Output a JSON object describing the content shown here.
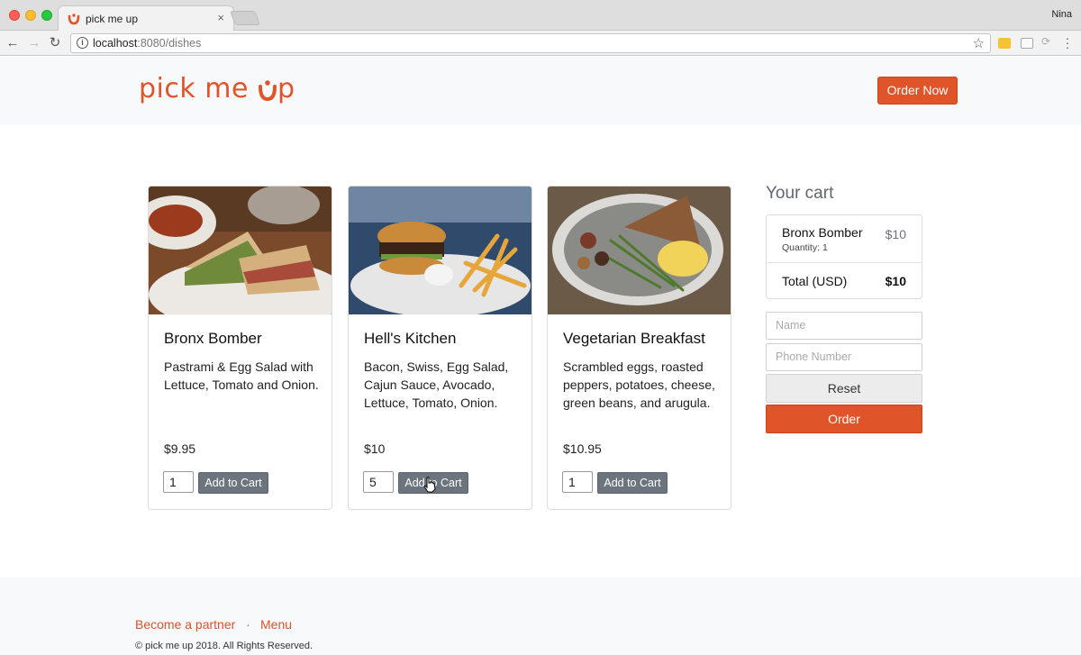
{
  "browser": {
    "tab_title": "pick me up",
    "tab_close": "×",
    "profile_name": "Nina",
    "url_host": "localhost",
    "url_path": ":8080/dishes",
    "brand_color": "#e0542a"
  },
  "header": {
    "logo_part1": "pick me ",
    "logo_part2": "p",
    "order_now_label": "Order Now"
  },
  "dishes": [
    {
      "title": "Bronx Bomber",
      "description": "Pastrami & Egg Salad with Lettuce, Tomato and Onion.",
      "price": "$9.95",
      "quantity": "1",
      "button_label": "Add to Cart"
    },
    {
      "title": "Hell's Kitchen",
      "description": "Bacon, Swiss, Egg Salad, Cajun Sauce, Avocado, Lettuce, Tomato, Onion.",
      "price": "$10",
      "quantity": "5",
      "button_label": "Add to Cart"
    },
    {
      "title": "Vegetarian Breakfast",
      "description": "Scrambled eggs, roasted peppers, potatoes, cheese, green beans, and arugula.",
      "price": "$10.95",
      "quantity": "1",
      "button_label": "Add to Cart"
    }
  ],
  "cart": {
    "title": "Your cart",
    "item_name": "Bronx Bomber",
    "item_quantity": "Quantity: 1",
    "item_price": "$10",
    "total_label": "Total (USD)",
    "total_value": "$10",
    "name_placeholder": "Name",
    "phone_placeholder": "Phone Number",
    "reset_label": "Reset",
    "order_label": "Order"
  },
  "footer": {
    "partner_link": "Become a partner",
    "separator": "·",
    "menu_link": "Menu",
    "copyright": "© pick me up 2018. All Rights Reserved."
  }
}
